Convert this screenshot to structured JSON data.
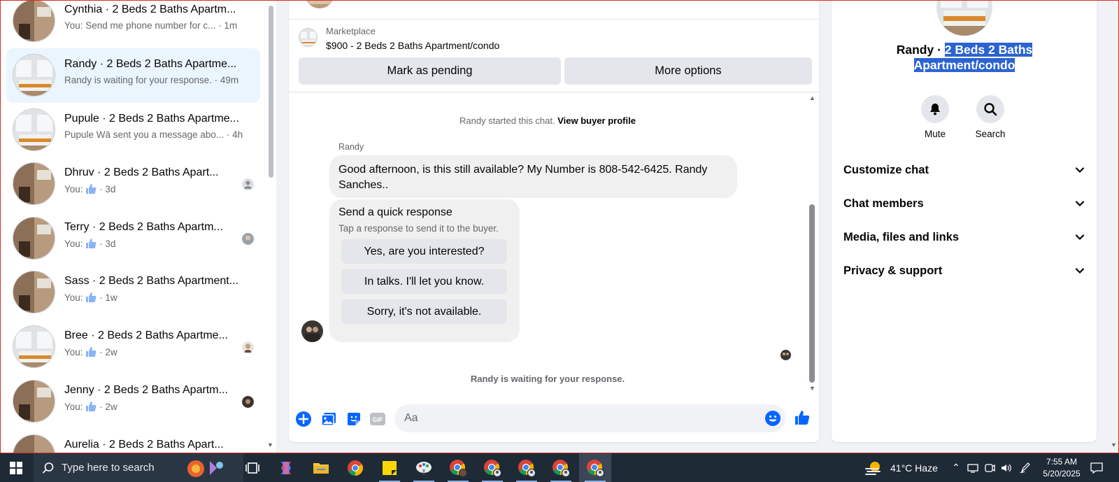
{
  "conversations": [
    {
      "name": "Cynthia · 2 Beds 2 Baths Apartm...",
      "preview": "You: Send me phone number for c...",
      "time": "· 1m",
      "liked": false,
      "active": false
    },
    {
      "name": "Randy · 2 Beds 2 Baths Apartme...",
      "preview": "Randy is waiting for your response.",
      "time": "· 49m",
      "liked": false,
      "active": true
    },
    {
      "name": "Pupule · 2 Beds 2 Baths Apartme...",
      "preview": "Pupule Wā sent you a message abo...",
      "time": "· 4h",
      "liked": false,
      "active": false
    },
    {
      "name": "Dhruv · 2 Beds 2 Baths Apart...",
      "preview": "You:",
      "time": "· 3d",
      "liked": true,
      "active": false
    },
    {
      "name": "Terry · 2 Beds 2 Baths Apartm...",
      "preview": "You:",
      "time": "· 3d",
      "liked": true,
      "active": false
    },
    {
      "name": "Sass · 2 Beds 2 Baths Apartment...",
      "preview": "You:",
      "time": "· 1w",
      "liked": true,
      "active": false
    },
    {
      "name": "Bree · 2 Beds 2 Baths Apartme...",
      "preview": "You:",
      "time": "· 2w",
      "liked": true,
      "active": false
    },
    {
      "name": "Jenny · 2 Beds 2 Baths Apartm...",
      "preview": "You:",
      "time": "· 2w",
      "liked": true,
      "active": false
    },
    {
      "name": "Aurelia · 2 Beds 2 Baths Apart...",
      "preview": "",
      "time": "",
      "liked": false,
      "active": false
    }
  ],
  "listing": {
    "label": "Marketplace",
    "title": "$900 - 2 Beds 2 Baths Apartment/condo",
    "pending_button": "Mark as pending",
    "more_button": "More options"
  },
  "chat": {
    "started_text": "Randy started this chat.",
    "view_profile_link": "View buyer profile",
    "sender": "Randy",
    "message": "Good afternoon, is this still available? My Number is 808-542-6425. Randy Sanches..",
    "quick_title": "Send a quick response",
    "quick_subtitle": "Tap a response to send it to the buyer.",
    "quick_responses": [
      "Yes, are you interested?",
      "In talks. I'll let you know.",
      "Sorry, it's not available."
    ],
    "waiting_text": "Randy is waiting for your response."
  },
  "composer": {
    "placeholder": "Aa",
    "icons": [
      "plus-icon",
      "photo-icon",
      "sticker-icon",
      "gif-icon",
      "emoji-icon",
      "like-icon"
    ],
    "gif_label": "GIF"
  },
  "details": {
    "title_prefix": "Randy · ",
    "title_selected_1": "2 Beds 2 Baths",
    "title_selected_2": "Apartment/condo",
    "actions": [
      {
        "label": "Mute",
        "icon": "bell-icon"
      },
      {
        "label": "Search",
        "icon": "search-icon"
      }
    ],
    "sections": [
      "Customize chat",
      "Chat members",
      "Media, files and links",
      "Privacy & support"
    ]
  },
  "taskbar": {
    "search_placeholder": "Type here to search",
    "weather": "41°C  Haze",
    "time": "7:55 AM",
    "date": "5/20/2025"
  },
  "colors": {
    "accent": "#0866ff",
    "active_row": "#ebf5ff",
    "bubble": "#f0f0f0",
    "selection": "#2b64d1",
    "taskbar": "#1f2a37"
  }
}
